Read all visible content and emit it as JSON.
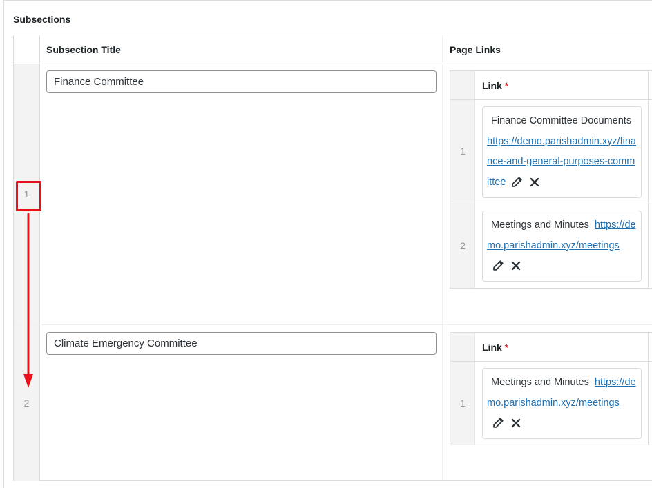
{
  "section": {
    "label": "Subsections"
  },
  "columns": {
    "title": "Subsection Title",
    "links": "Page Links",
    "link": "Link",
    "required_mark": "*"
  },
  "rows": [
    {
      "order": "1",
      "title": "Finance Committee",
      "links": [
        {
          "order": "1",
          "title": "Finance Committee Documents",
          "url": "https://demo.parishadmin.xyz/finance-and-general-purposes-committee"
        },
        {
          "order": "2",
          "title": "Meetings and Minutes",
          "url": "https://demo.parishadmin.xyz/meetings"
        }
      ]
    },
    {
      "order": "2",
      "title": "Climate Emergency Committee",
      "links": [
        {
          "order": "1",
          "title": "Meetings and Minutes",
          "url": "https://demo.parishadmin.xyz/meetings"
        }
      ]
    }
  ],
  "icons": {
    "edit": "pencil-icon",
    "remove": "close-icon"
  },
  "annotation": {
    "color": "#e8101b"
  },
  "colors": {
    "link": "#2271b1",
    "required": "#d63638",
    "border": "#dcdcde"
  }
}
